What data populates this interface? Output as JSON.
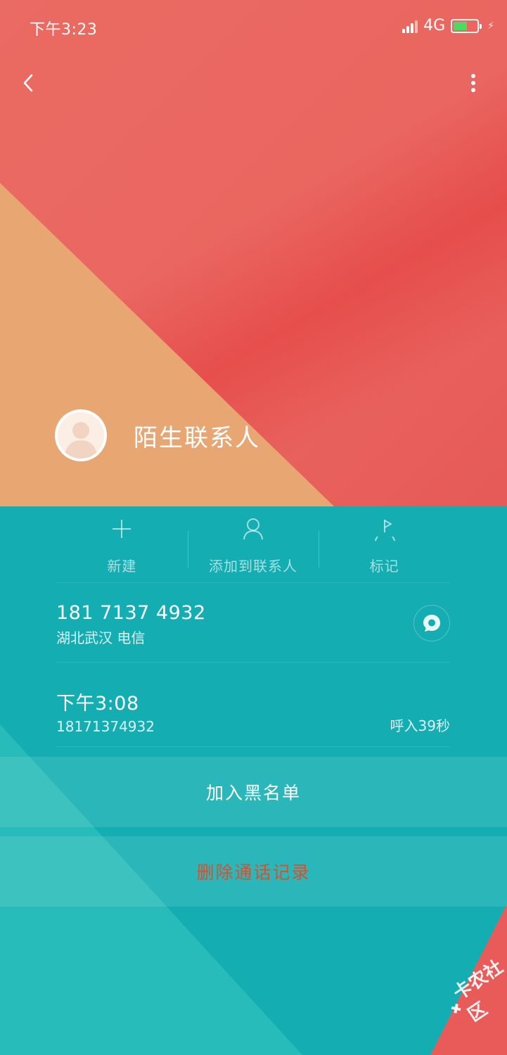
{
  "status_bar": {
    "time": "下午3:23",
    "network": "4G",
    "battery_level": 0.6
  },
  "contact": {
    "name": "陌生联系人"
  },
  "actions": [
    {
      "label": "新建",
      "icon": "plus-icon"
    },
    {
      "label": "添加到联系人",
      "icon": "person-icon"
    },
    {
      "label": "标记",
      "icon": "flag-icon"
    }
  ],
  "number_row": {
    "number": "181 7137 4932",
    "location": "湖北武汉 电信"
  },
  "call_log": {
    "time": "下午3:08",
    "number": "18171374932",
    "duration": "呼入39秒"
  },
  "buttons": {
    "blacklist": "加入黑名单",
    "delete": "删除通话记录"
  },
  "watermark": "卡农社区",
  "colors": {
    "header": "#ea6660",
    "accent_orange": "#e8a672",
    "teal": "#14aeb2",
    "delete_text": "#d7502f"
  }
}
